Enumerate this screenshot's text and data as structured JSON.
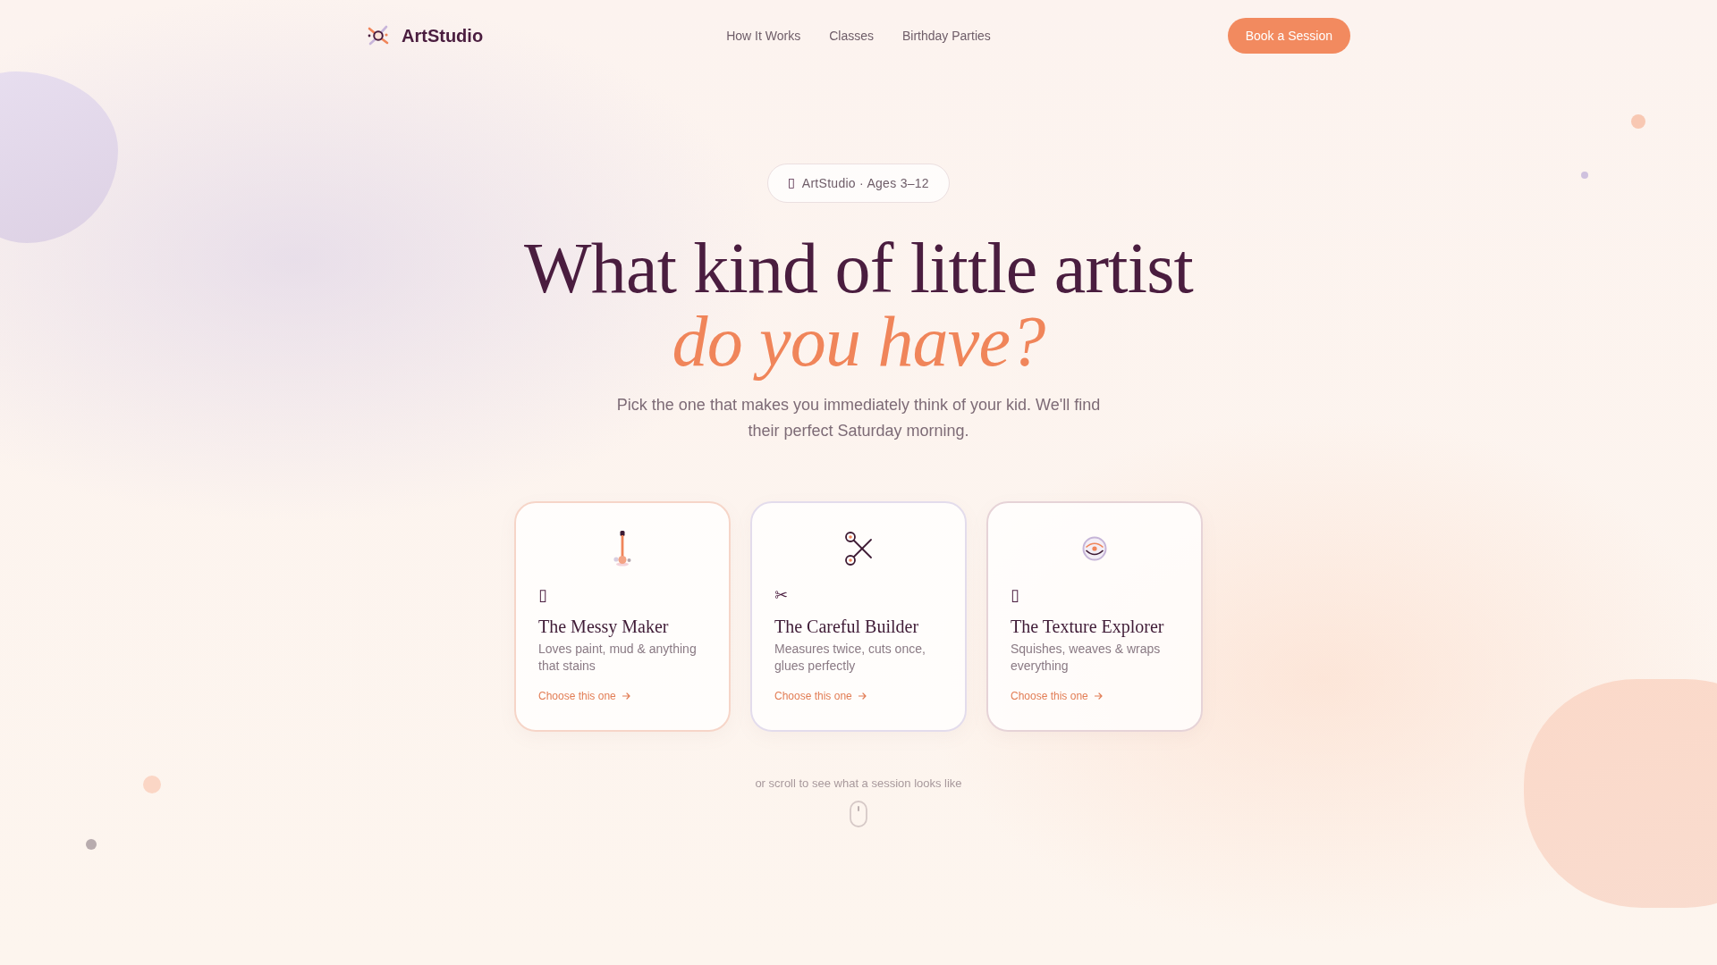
{
  "header": {
    "brand": "ArtStudio",
    "nav": [
      "How It Works",
      "Classes",
      "Birthday Parties"
    ],
    "cta": "Book a Session"
  },
  "hero": {
    "badge": {
      "mark": "▯",
      "text": "ArtStudio · Ages 3–12"
    },
    "title": "What kind of little artist",
    "title_accent": "do you have?",
    "subtitle": "Pick the one that makes you immediately think of your kid. We'll find their perfect Saturday morning."
  },
  "cards": [
    {
      "kind": "paint",
      "mark": "▯",
      "title": "The Messy Maker",
      "description": "Loves paint, mud & anything that stains",
      "link": "Choose this one",
      "color": "#f6d5c8"
    },
    {
      "kind": "scissors",
      "mark": "✂",
      "title": "The Careful Builder",
      "description": "Measures twice, cuts once, glues perfectly",
      "link": "Choose this one",
      "color": "#e3dcec"
    },
    {
      "kind": "texture",
      "mark": "▯",
      "title": "The Texture Explorer",
      "description": "Squishes, weaves & wraps everything",
      "link": "Choose this one",
      "color": "#e6d3d7"
    }
  ],
  "scroll_hint": "or scroll to see what a session looks like"
}
